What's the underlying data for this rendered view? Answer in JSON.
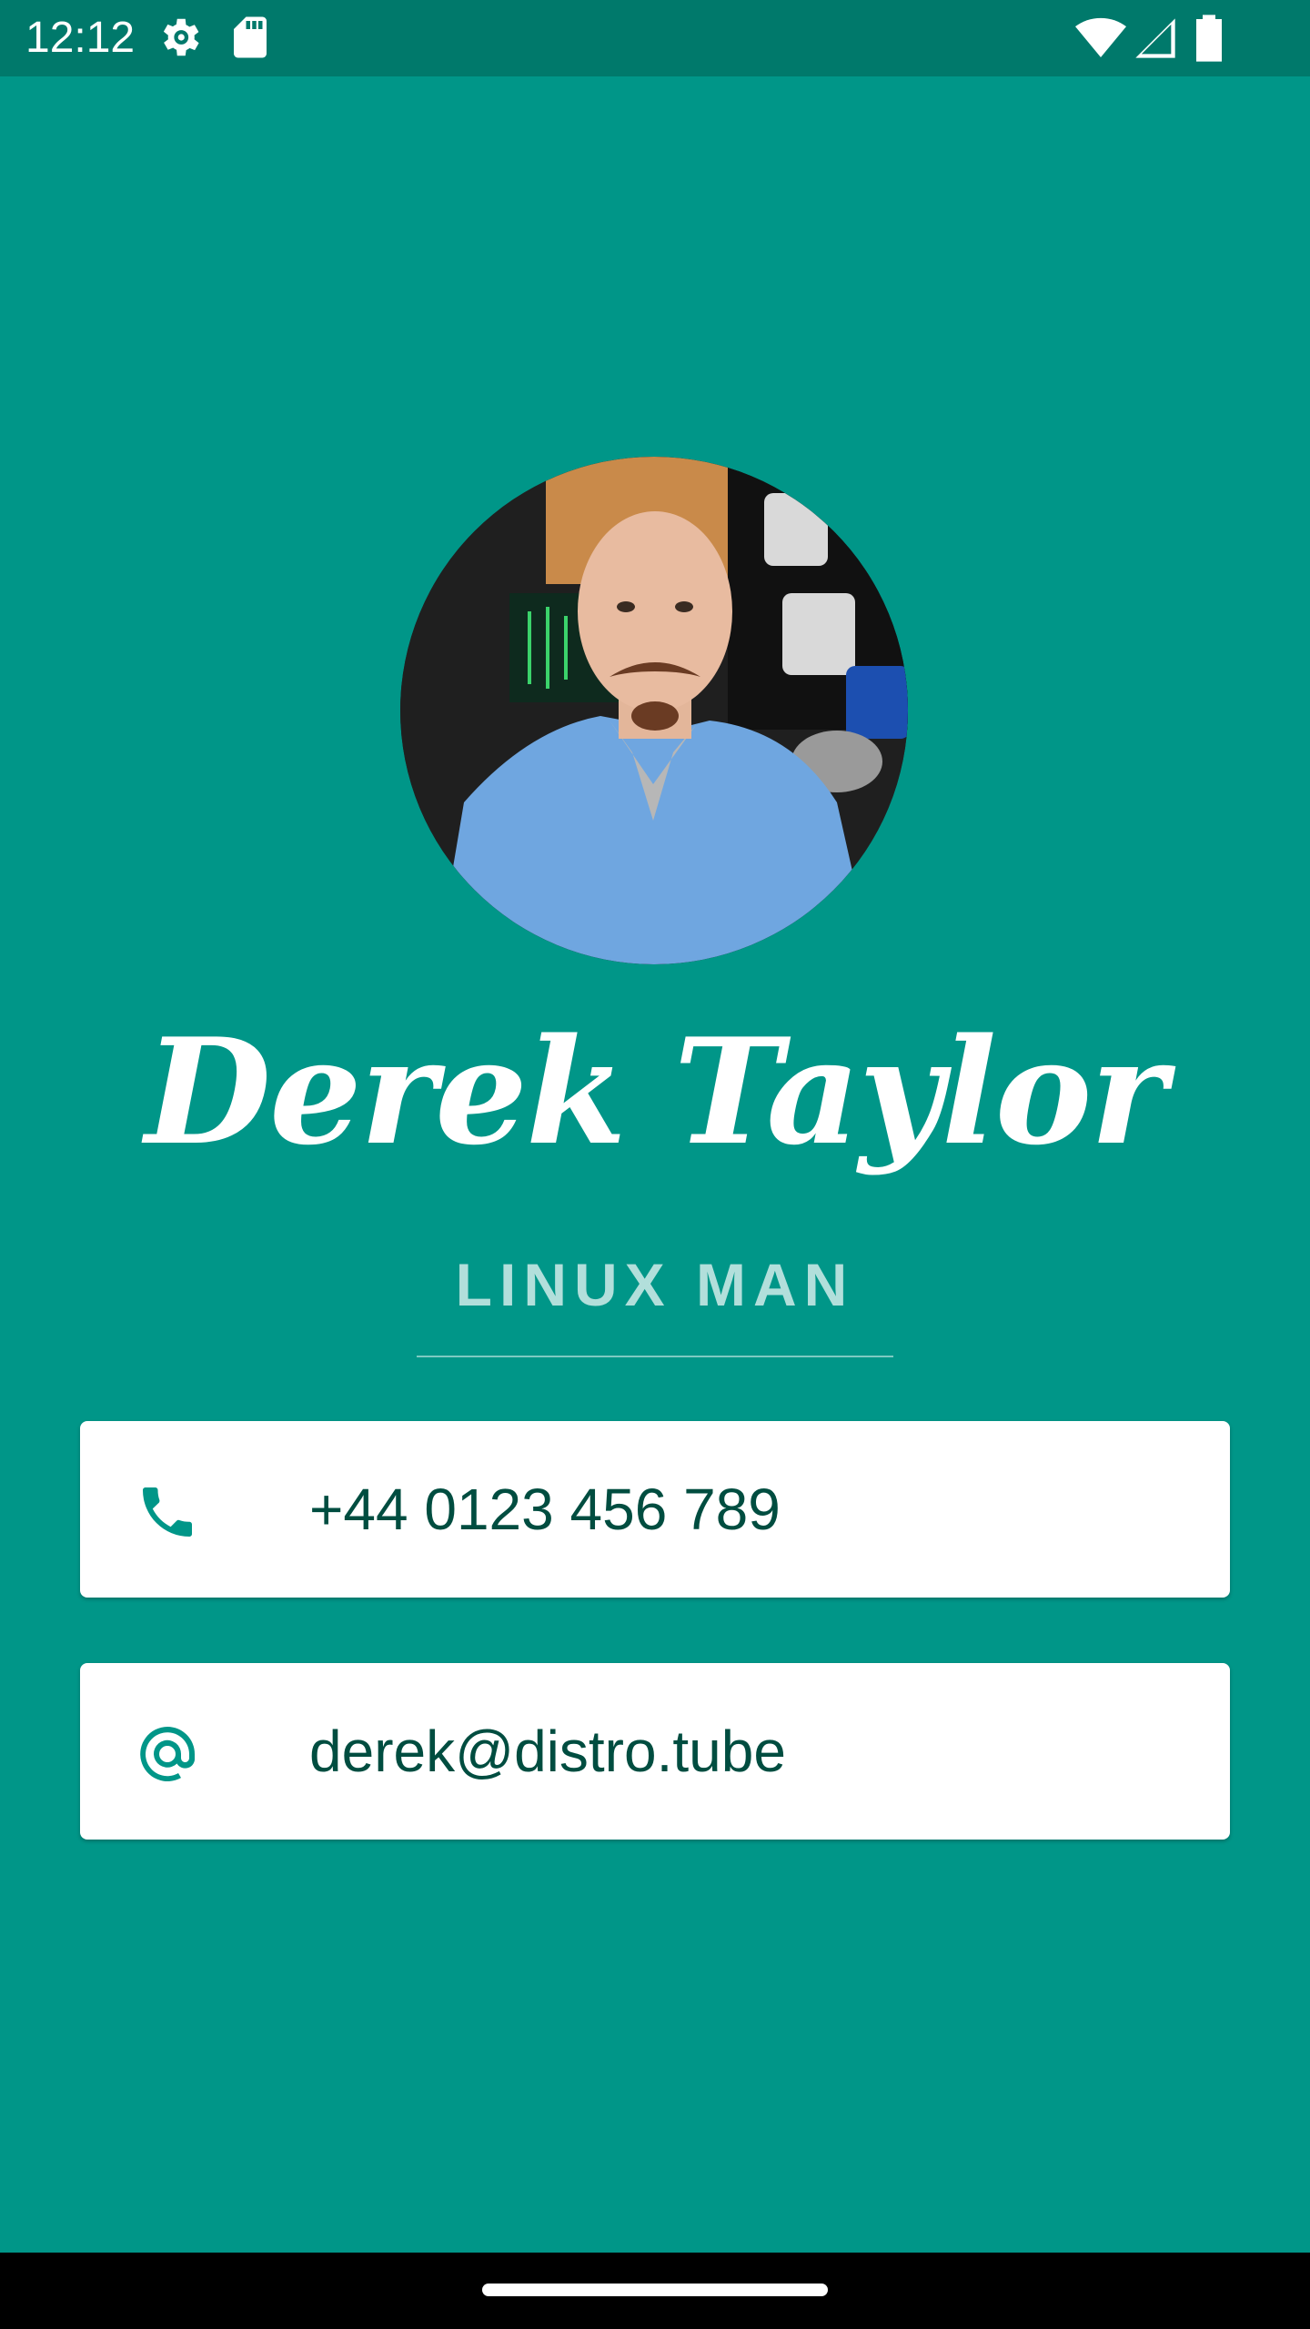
{
  "status_bar": {
    "time": "12:12",
    "icons": [
      "settings-icon",
      "sd-card-icon",
      "wifi-icon",
      "signal-icon",
      "battery-icon"
    ]
  },
  "profile": {
    "name": "Derek Taylor",
    "title": "LINUX MAN",
    "photo_desc_icon": "profile-photo"
  },
  "contacts": [
    {
      "icon": "phone-icon",
      "value": "+44 0123 456 789"
    },
    {
      "icon": "at-sign-icon",
      "value": "derek@distro.tube"
    }
  ],
  "colors": {
    "background": "#009688",
    "status_bar": "#00796b",
    "subtitle": "#b2dfdb",
    "card_text": "#004d40",
    "card_icon": "#009688"
  }
}
